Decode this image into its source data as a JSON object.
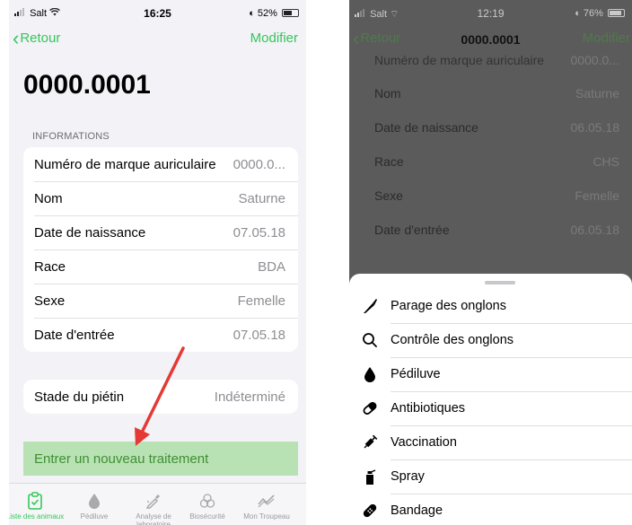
{
  "left": {
    "status": {
      "carrier": "Salt",
      "time": "16:25",
      "battery": "52%"
    },
    "nav": {
      "back": "Retour",
      "edit": "Modifier"
    },
    "title": "0000.0001",
    "section_header": "INFORMATIONS",
    "info_rows": [
      {
        "label": "Numéro de marque auriculaire",
        "value": "0000.0..."
      },
      {
        "label": "Nom",
        "value": "Saturne"
      },
      {
        "label": "Date de naissance",
        "value": "07.05.18"
      },
      {
        "label": "Race",
        "value": "BDA"
      },
      {
        "label": "Sexe",
        "value": "Femelle"
      },
      {
        "label": "Date d'entrée",
        "value": "07.05.18"
      }
    ],
    "stage": {
      "label": "Stade du piétin",
      "value": "Indéterminé"
    },
    "action": "Entrer un nouveau traitement",
    "tabs": [
      {
        "label": "Liste des animaux",
        "icon": "clipboard-check-icon"
      },
      {
        "label": "Pédiluve",
        "icon": "drop-icon"
      },
      {
        "label": "Analyse de laboratoire",
        "icon": "pipette-icon"
      },
      {
        "label": "Biosécurité",
        "icon": "biohazard-icon"
      },
      {
        "label": "Mon Troupeau",
        "icon": "trend-chart-icon"
      }
    ],
    "accent": "#34c759",
    "annotation_color": "#e53935"
  },
  "right": {
    "status": {
      "carrier": "Salt",
      "time": "12:19",
      "battery": "76%"
    },
    "nav": {
      "back": "Retour",
      "title": "0000.0001",
      "edit": "Modifier"
    },
    "cut_row": {
      "label": "Numéro de marque auriculaire",
      "value": "0000.0..."
    },
    "rows": [
      {
        "label": "Nom",
        "value": "Saturne"
      },
      {
        "label": "Date de naissance",
        "value": "06.05.18"
      },
      {
        "label": "Race",
        "value": "CHS"
      },
      {
        "label": "Sexe",
        "value": "Femelle"
      },
      {
        "label": "Date d'entrée",
        "value": "06.05.18"
      }
    ],
    "menu": [
      {
        "label": "Parage des onglons",
        "icon": "knife-icon"
      },
      {
        "label": "Contrôle des onglons",
        "icon": "search-icon"
      },
      {
        "label": "Pédiluve",
        "icon": "drop-icon"
      },
      {
        "label": "Antibiotiques",
        "icon": "pill-icon"
      },
      {
        "label": "Vaccination",
        "icon": "syringe-icon"
      },
      {
        "label": "Spray",
        "icon": "spray-icon"
      },
      {
        "label": "Bandage",
        "icon": "bandage-icon"
      }
    ]
  }
}
